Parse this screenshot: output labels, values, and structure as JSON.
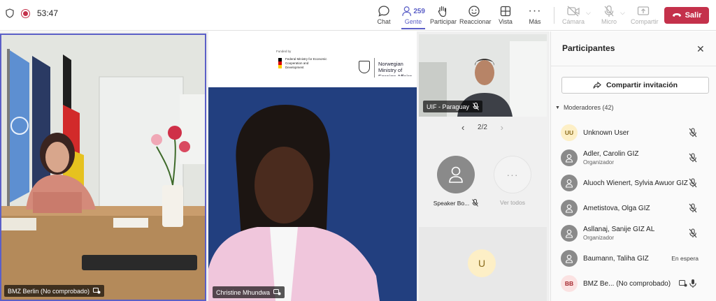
{
  "call": {
    "timer": "53:47"
  },
  "toolbar": {
    "chat": "Chat",
    "people": "Gente",
    "people_count": "259",
    "raise": "Participar",
    "react": "Reaccionar",
    "view": "Vista",
    "more": "Más",
    "camera": "Cámara",
    "mic": "Micro",
    "share": "Compartir",
    "leave": "Salir"
  },
  "stage": {
    "tile1_name": "BMZ Berlin (No comprobado)",
    "tile2_name": "Christine Mhundwa",
    "tile2_banner": {
      "funded_by": "Funded by",
      "ministry": "Federal Ministry for Economic Cooperation and Development",
      "norway": "Norwegian Ministry of Foreign Affairs"
    },
    "tile3_name": "UIF - Paraguay",
    "pagination": "2/2",
    "speaker_label": "Speaker Bo...",
    "see_all": "Ver todos",
    "u_initial": "U"
  },
  "panel": {
    "title": "Participantes",
    "invite": "Compartir invitación",
    "section": "Moderadores (42)",
    "participants": [
      {
        "initials": "UU",
        "name": "Unknown User",
        "role": "",
        "status": "",
        "avatar_bg": "#fdefc6",
        "avatar_fg": "#8a6b1c"
      },
      {
        "initials": "",
        "name": "Adler, Carolin GIZ",
        "role": "Organizador",
        "status": "",
        "avatar_bg": "#8a8a8a",
        "avatar_fg": "#ffffff"
      },
      {
        "initials": "",
        "name": "Aluoch Wienert, Sylvia Awuor GIZ",
        "role": "",
        "status": "",
        "avatar_bg": "#8a8a8a",
        "avatar_fg": "#ffffff"
      },
      {
        "initials": "",
        "name": "Ametistova, Olga GIZ",
        "role": "",
        "status": "",
        "avatar_bg": "#8a8a8a",
        "avatar_fg": "#ffffff"
      },
      {
        "initials": "",
        "name": "Asllanaj, Sanije GIZ AL",
        "role": "Organizador",
        "status": "",
        "avatar_bg": "#8a8a8a",
        "avatar_fg": "#ffffff"
      },
      {
        "initials": "",
        "name": "Baumann, Taliha GIZ",
        "role": "",
        "status": "En espera",
        "avatar_bg": "#8a8a8a",
        "avatar_fg": "#ffffff"
      },
      {
        "initials": "BB",
        "name": "BMZ Be...  (No comprobado)",
        "role": "",
        "status": "",
        "avatar_bg": "#fbe2e2",
        "avatar_fg": "#a4262c"
      }
    ]
  },
  "colors": {
    "accent": "#5b5fc7",
    "leave": "#c4314b"
  }
}
